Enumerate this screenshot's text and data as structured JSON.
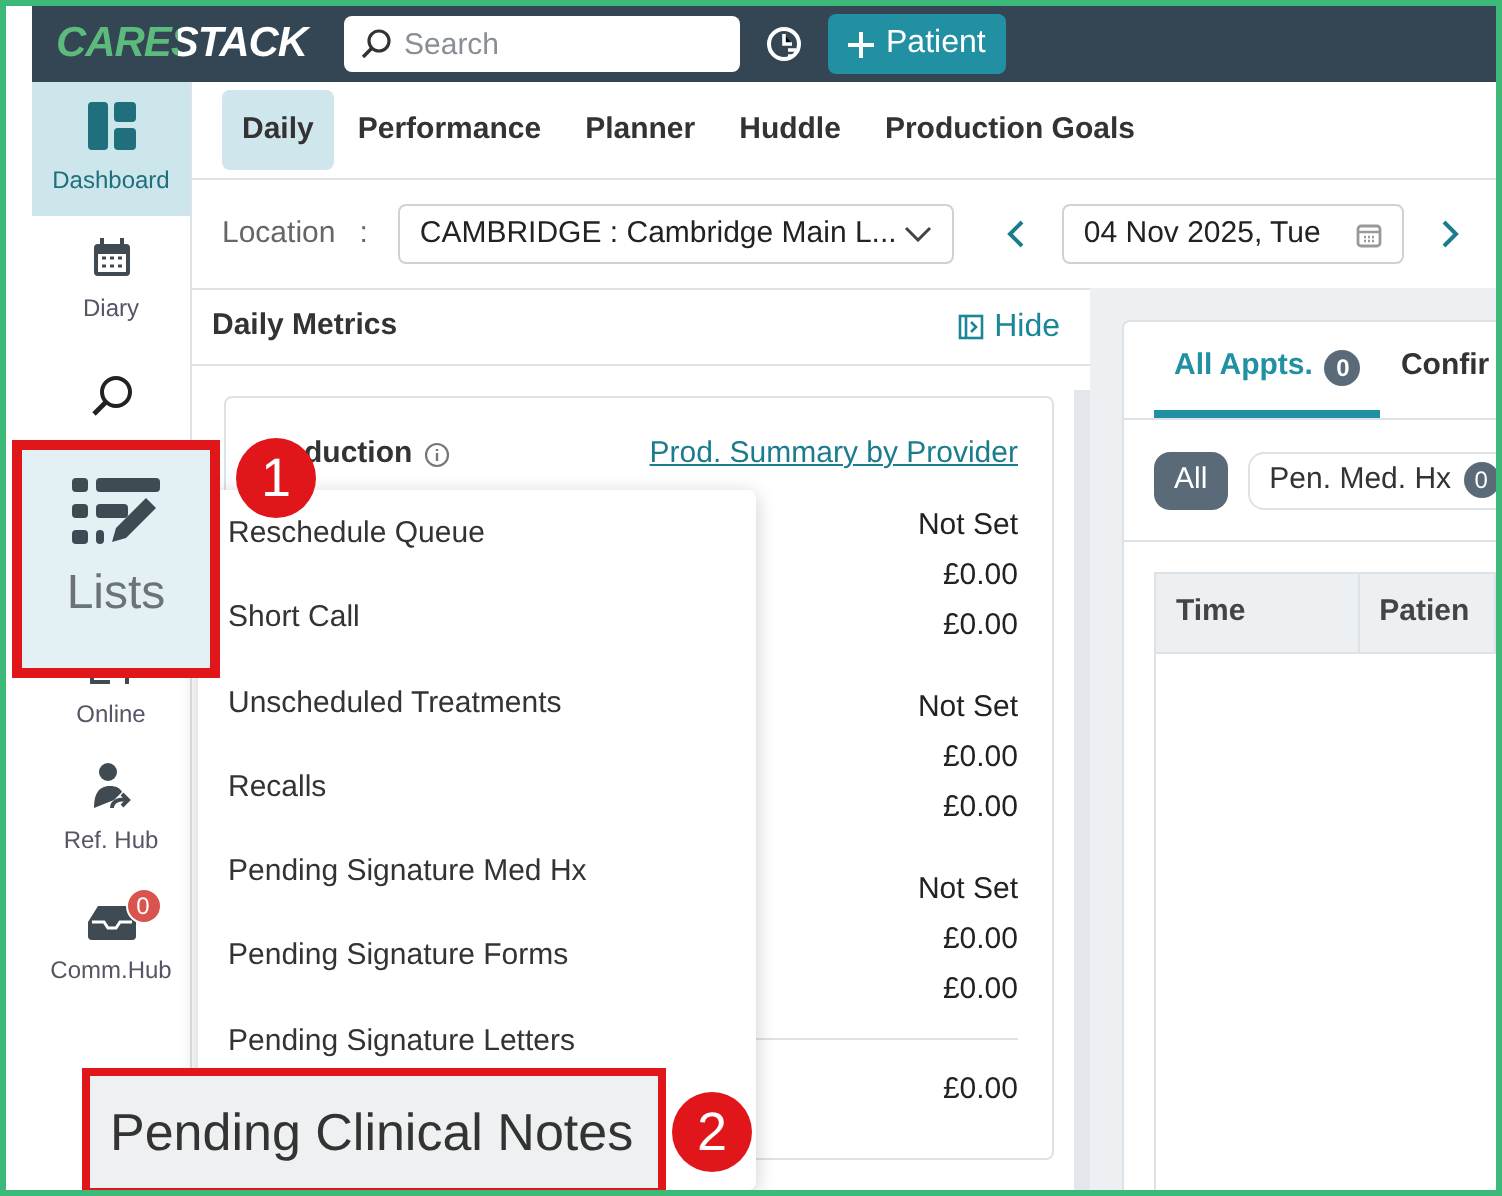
{
  "header": {
    "logo": "CARESTACK",
    "search": {
      "placeholder": "Search"
    },
    "new_patient_button": "Patient"
  },
  "sidebar": {
    "items": [
      {
        "kind": "dashboard",
        "label": "Dashboard",
        "selected": true
      },
      {
        "kind": "diary",
        "label": "Diary",
        "selected": false
      },
      {
        "kind": "search",
        "selected": false
      },
      {
        "kind": "online",
        "label": "Online",
        "selected": false
      },
      {
        "kind": "refhub",
        "label": "Ref. Hub",
        "selected": false
      },
      {
        "kind": "commhub",
        "label": "Comm.Hub",
        "badge": "0",
        "selected": false
      }
    ]
  },
  "tabs": [
    {
      "label": "Daily",
      "selected": true
    },
    {
      "label": "Performance",
      "selected": false
    },
    {
      "label": "Planner",
      "selected": false
    },
    {
      "label": "Huddle",
      "selected": false
    },
    {
      "label": "Production Goals",
      "selected": false
    }
  ],
  "filters": {
    "location_label": "Location",
    "separator": ":",
    "location": "CAMBRIDGE : Cambridge Main L...",
    "date": "04 Nov 2025, Tue"
  },
  "daily_metrics": {
    "title": "Daily Metrics",
    "hide": "Hide",
    "card": {
      "title": "duction",
      "link": "Prod. Summary by Provider",
      "values": [
        [
          "Not Set",
          "£0.00",
          "£0.00"
        ],
        [
          "Not Set",
          "£0.00",
          "£0.00"
        ],
        [
          "Not Set",
          "£0.00",
          "£0.00"
        ]
      ],
      "total": "£0.00"
    }
  },
  "lists_menu": {
    "items": [
      "Reschedule Queue",
      "Short Call",
      "Unscheduled Treatments",
      "Recalls",
      "Pending Signature Med Hx",
      "Pending Signature Forms",
      "Pending Signature Letters"
    ]
  },
  "appointments": {
    "tabs": [
      {
        "label": "All Appts.",
        "count": "0",
        "selected": true
      },
      {
        "label": "Confir",
        "selected": false
      }
    ],
    "chips": [
      {
        "label": "All",
        "selected": true
      },
      {
        "label": "Pen. Med. Hx",
        "count": "0",
        "selected": false
      }
    ],
    "columns": [
      "Time",
      "Patien"
    ]
  },
  "annotations": {
    "lists_callout": "Lists",
    "clinical_notes_callout": "Pending Clinical Notes",
    "markers": [
      "1",
      "2"
    ]
  }
}
